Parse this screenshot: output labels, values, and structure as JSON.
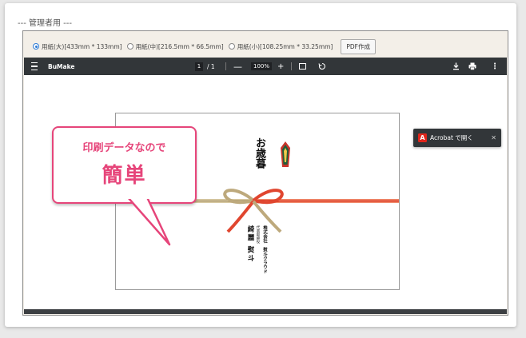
{
  "section_label": "--- 管理者用 ---",
  "paper_options": [
    {
      "label": "用紙(大)[433mm * 133mm]",
      "selected": true
    },
    {
      "label": "用紙(中)[216.5mm * 66.5mm]",
      "selected": false
    },
    {
      "label": "用紙(小)[108.25mm * 33.25mm]",
      "selected": false
    }
  ],
  "pdf_button_label": "PDF作成",
  "viewer": {
    "title": "BuMake",
    "page_current": "1",
    "page_total": "/ 1",
    "zoom": "100%",
    "minus": "—",
    "plus": "+"
  },
  "acrobat": {
    "icon_letter": "A",
    "label": "Acrobat で開く",
    "close": "✕"
  },
  "bubble": {
    "line1": "印刷データなので",
    "line2": "簡単"
  },
  "document": {
    "omote": "お歳暮",
    "company": "株式会社　熨斗クラウド",
    "representative_title": "代表取締役",
    "person": "綺麗 熨斗"
  },
  "colors": {
    "accent_pink": "#e6457a",
    "viewer_bar": "#323639",
    "radio_selected": "#2e7bd6",
    "acrobat_red": "#e1251b"
  }
}
